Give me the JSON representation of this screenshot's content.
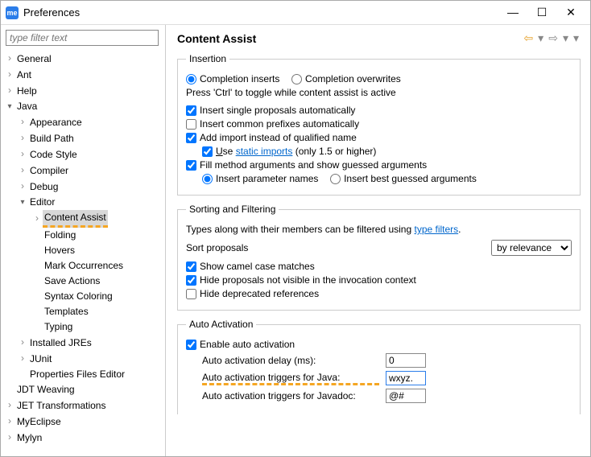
{
  "window": {
    "title": "Preferences",
    "app_icon_text": "me"
  },
  "filter": {
    "placeholder": "type filter text"
  },
  "tree": {
    "general": "General",
    "ant": "Ant",
    "help": "Help",
    "java": "Java",
    "appearance": "Appearance",
    "build_path": "Build Path",
    "code_style": "Code Style",
    "compiler": "Compiler",
    "debug": "Debug",
    "editor": "Editor",
    "content_assist": "Content Assist",
    "folding": "Folding",
    "hovers": "Hovers",
    "mark_occurrences": "Mark Occurrences",
    "save_actions": "Save Actions",
    "syntax_coloring": "Syntax Coloring",
    "templates": "Templates",
    "typing": "Typing",
    "installed_jres": "Installed JREs",
    "junit": "JUnit",
    "properties_files_editor": "Properties Files Editor",
    "jdt_weaving": "JDT Weaving",
    "jet_transformations": "JET Transformations",
    "myeclipse": "MyEclipse",
    "mylyn": "Mylyn"
  },
  "main": {
    "title": "Content Assist",
    "insertion": {
      "legend": "Insertion",
      "completion_inserts": "Completion inserts",
      "completion_overwrites": "Completion overwrites",
      "press_ctrl": "Press 'Ctrl' to toggle while content assist is active",
      "insert_single": "Insert single proposals automatically",
      "insert_common": "Insert common prefixes automatically",
      "add_import": "Add import instead of qualified name",
      "use_prefix": "U",
      "use_suffix": "se ",
      "static_imports": "static imports",
      "static_hint": " (only 1.5 or higher)",
      "fill_method": "Fill method arguments and show guessed arguments",
      "insert_param": "Insert parameter names",
      "insert_best": "Insert best guessed arguments"
    },
    "sorting": {
      "legend": "Sorting and Filtering",
      "types_filtered": "Types along with their members can be filtered using ",
      "type_filters": "type filters",
      "sort_proposals": "Sort proposals",
      "by_relevance": "by relevance",
      "show_camel": "Show camel case matches",
      "hide_proposals": "Hide proposals not visible in the invocation context",
      "hide_deprecated": "Hide deprecated references"
    },
    "auto": {
      "legend": "Auto Activation",
      "enable": "Enable auto activation",
      "delay_label": "Auto activation delay (ms):",
      "delay_value": "0",
      "triggers_java_label": "Auto activation triggers for Java:",
      "triggers_java_value": "wxyz.",
      "triggers_javadoc_label": "Auto activation triggers for Javadoc:",
      "triggers_javadoc_value": "@#"
    }
  }
}
